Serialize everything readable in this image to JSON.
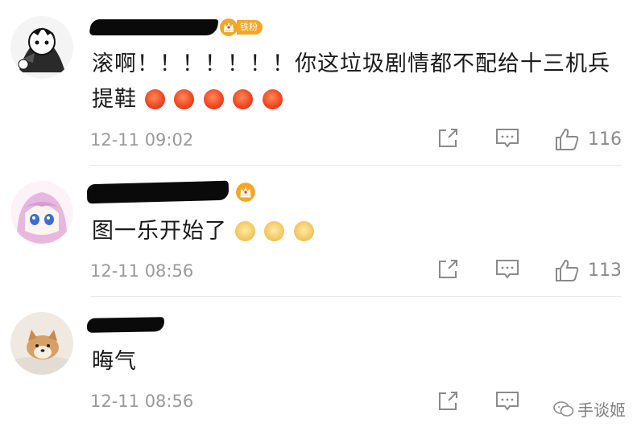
{
  "comments": [
    {
      "badge": "铁粉",
      "text": "滚啊！！！！！！！你这垃圾剧情都不配给十三机兵",
      "text_line2": "提鞋",
      "emoji": "angry-face",
      "emoji_count": 5,
      "time": "12-11 09:02",
      "likes": "116"
    },
    {
      "badge": "",
      "text": "图一乐开始了",
      "emoji": "doge-face",
      "emoji_count": 3,
      "time": "12-11 08:56",
      "likes": "113"
    },
    {
      "text": "晦气",
      "time": "12-11 08:56"
    }
  ],
  "watermark": "手谈姬",
  "colors": {
    "badge": "#f5a623",
    "muted": "#9a9a9a",
    "text": "#1a1a1a"
  }
}
